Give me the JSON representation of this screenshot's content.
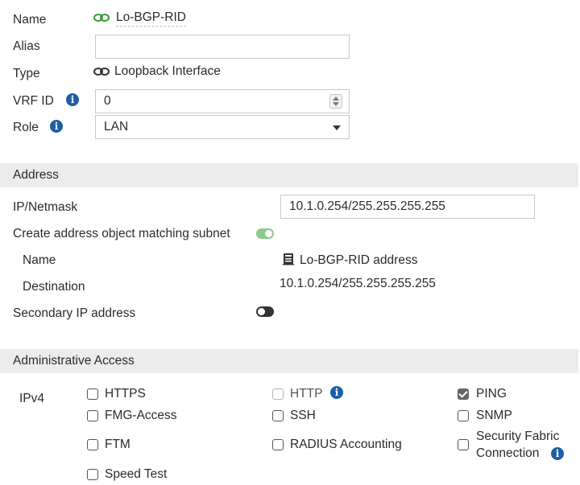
{
  "interface": {
    "name_label": "Name",
    "name_value": "Lo-BGP-RID",
    "alias_label": "Alias",
    "alias_value": "",
    "type_label": "Type",
    "type_value": "Loopback Interface",
    "vrf_label": "VRF ID",
    "vrf_value": "0",
    "role_label": "Role",
    "role_value": "LAN"
  },
  "address": {
    "section_title": "Address",
    "ip_label": "IP/Netmask",
    "ip_value": "10.1.0.254/255.255.255.255",
    "create_obj_label": "Create address object matching subnet",
    "create_obj_enabled": true,
    "obj_name_label": "Name",
    "obj_name_value": "Lo-BGP-RID address",
    "destination_label": "Destination",
    "destination_value": "10.1.0.254/255.255.255.255",
    "secondary_label": "Secondary IP address",
    "secondary_enabled": false
  },
  "admin_access": {
    "section_title": "Administrative Access",
    "ipv4_label": "IPv4",
    "options": {
      "https": {
        "label": "HTTPS",
        "checked": false
      },
      "http": {
        "label": "HTTP",
        "checked": false,
        "disabled": true
      },
      "ping": {
        "label": "PING",
        "checked": true
      },
      "fmg": {
        "label": "FMG-Access",
        "checked": false
      },
      "ssh": {
        "label": "SSH",
        "checked": false
      },
      "snmp": {
        "label": "SNMP",
        "checked": false
      },
      "ftm": {
        "label": "FTM",
        "checked": false
      },
      "radius": {
        "label": "RADIUS Accounting",
        "checked": false
      },
      "fabric_line1": "Security Fabric",
      "fabric_line2": "Connection",
      "fabric": {
        "checked": false
      },
      "speedtest": {
        "label": "Speed Test",
        "checked": false
      }
    }
  },
  "colors": {
    "link_icon_green": "#3a9a3a",
    "toggle_on": "#8fc98f",
    "info_blue": "#1a5fa6",
    "section_bg": "#ececec"
  },
  "icons": {
    "name_icon": "link-icon",
    "type_icon": "link-icon",
    "info_icon": "info-icon",
    "address_object_icon": "address-object-icon"
  }
}
